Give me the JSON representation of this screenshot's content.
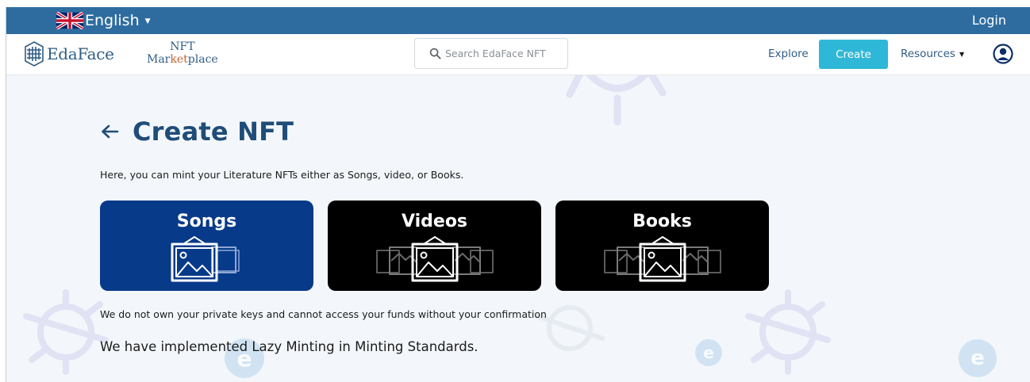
{
  "topbar": {
    "language": "English",
    "login": "Login"
  },
  "navbar": {
    "logo_text": {
      "eda": "Eda",
      "face": "Face"
    },
    "nft": "NFT",
    "marketplace": {
      "pre": "Mar",
      "accent": "ket",
      "post": "place"
    },
    "search_placeholder": "Search EdaFace NFT",
    "explore": "Explore",
    "create": "Create",
    "resources": "Resources"
  },
  "main": {
    "title": "Create NFT",
    "intro": "Here, you can mint your Literature NFTs either as Songs, video, or Books.",
    "cards": [
      {
        "label": "Songs",
        "color": "#073a89"
      },
      {
        "label": "Videos",
        "color": "#000000"
      },
      {
        "label": "Books",
        "color": "#000000"
      }
    ],
    "disclaimer": "We do not own your private keys and cannot access your funds without your confirmation",
    "lazy_minting": "We have implemented Lazy Minting in Minting Standards."
  },
  "colors": {
    "topbar": "#2e6ca0",
    "accent": "#2fb7d7",
    "title": "#1f4d78",
    "songs_card": "#073a89"
  },
  "icons": [
    "uk-flag-icon",
    "edaface-logo-icon",
    "search-icon",
    "user-circle-icon",
    "arrow-left-icon",
    "image-frame-icon",
    "caret-down-icon"
  ]
}
